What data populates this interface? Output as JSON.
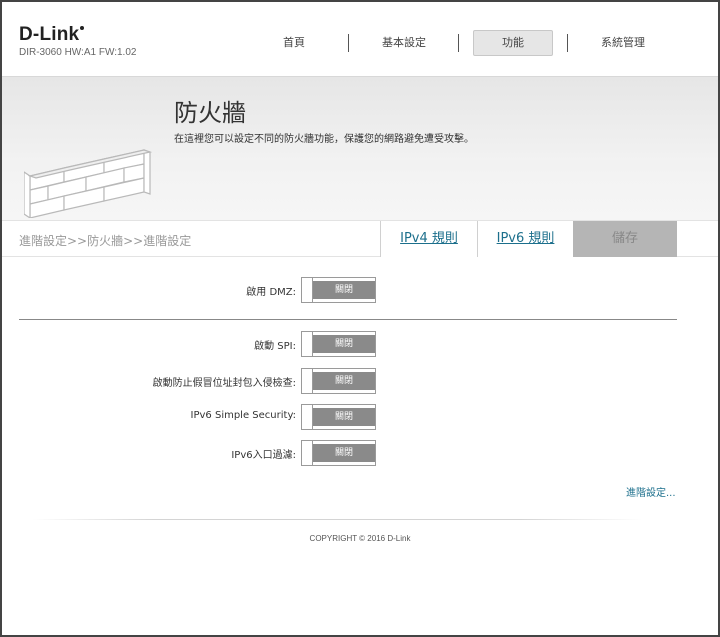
{
  "brand": {
    "logo": "D-Link",
    "model": "DIR-3060 HW:A1 FW:1.02"
  },
  "nav": {
    "items": [
      "首頁",
      "基本設定",
      "功能",
      "系統管理"
    ],
    "active": "功能"
  },
  "banner": {
    "title": "防火牆",
    "description": "在這裡您可以設定不同的防火牆功能，保護您的網路避免遭受攻擊。"
  },
  "tabbar": {
    "breadcrumb": "進階設定>>防火牆>>進階設定",
    "ipv4_rules": "IPv4 規則",
    "ipv6_rules": "IPv6 規則",
    "save": "儲存"
  },
  "dmz": {
    "label": "啟用 DMZ:",
    "state": "關閉"
  },
  "settings": [
    {
      "label": "啟動 SPI:",
      "state": "關閉"
    },
    {
      "label": "啟動防止假冒位址封包入侵檢查:",
      "state": "關閉"
    },
    {
      "label": "IPv6 Simple Security:",
      "state": "關閉"
    },
    {
      "label": "IPv6入口過濾:",
      "state": "關閉"
    }
  ],
  "advanced_link": "進階設定...",
  "footer": {
    "copyright": "COPYRIGHT © 2016 D-Link"
  },
  "colors": {
    "link": "#1c6f8c",
    "toggle_off": "#8a8a8a",
    "save_disabled": "#b5b5b5"
  }
}
